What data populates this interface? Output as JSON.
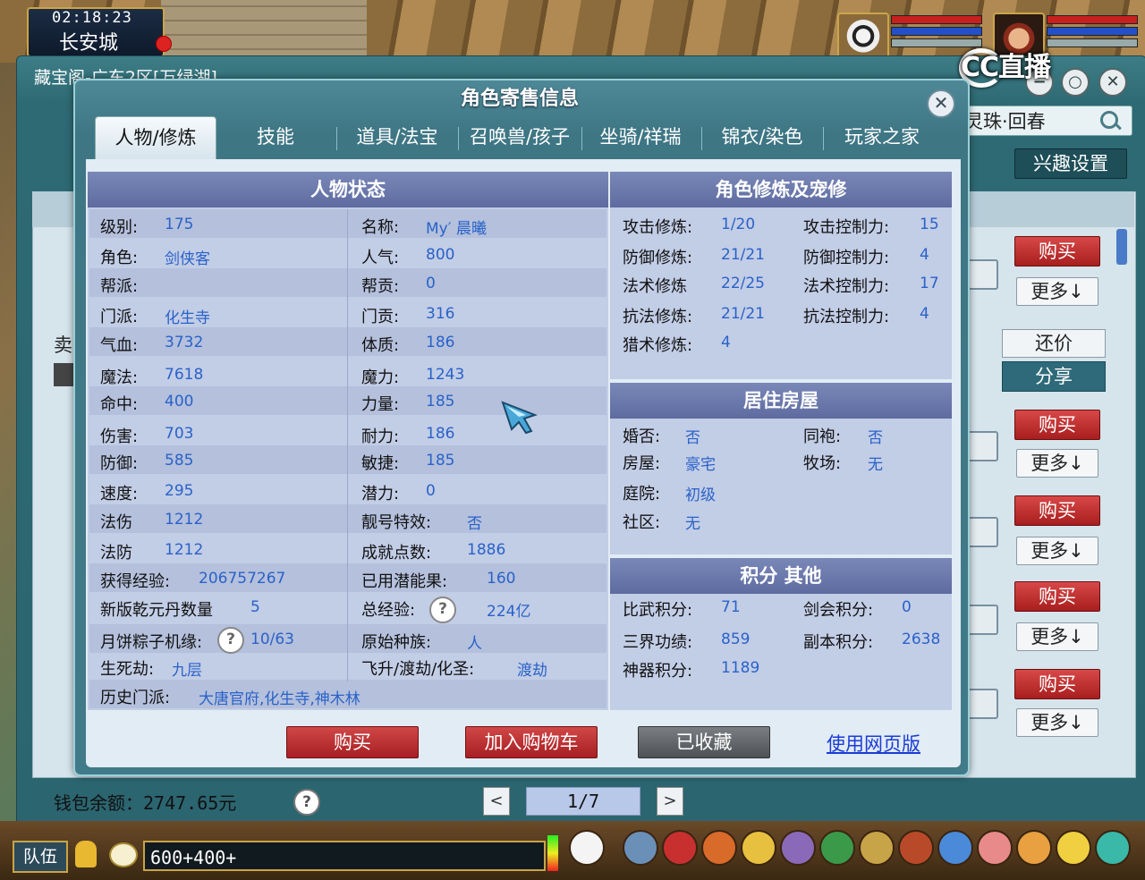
{
  "hud_top": {
    "clock": "02:18:23",
    "location": "长安城"
  },
  "stream_badge": "CC直播",
  "outer_window": {
    "title": "藏宝阁-广东2区[万绿湖]",
    "search_text": "灵珠·回春",
    "interest_button": "兴趣设置",
    "sell_label": "卖",
    "buy_label": "购买",
    "more_label": "更多↓",
    "counter_offer": "还价",
    "share": "分享",
    "wallet": "钱包余额：2747.65元",
    "help": "?",
    "page": "1/7",
    "prev": "<",
    "next": ">"
  },
  "dialog": {
    "title": "角色寄售信息",
    "close": "✕",
    "tabs": [
      "人物/修炼",
      "技能",
      "道具/法宝",
      "召唤兽/孩子",
      "坐骑/祥瑞",
      "锦衣/染色",
      "玩家之家"
    ],
    "status": {
      "header": "人物状态",
      "left": [
        {
          "label": "级别:",
          "value": "175"
        },
        {
          "label": "角色:",
          "value": "剑侠客"
        },
        {
          "label": "帮派:",
          "value": ""
        },
        {
          "label": "门派:",
          "value": "化生寺"
        },
        {
          "label": "气血:",
          "value": "3732"
        },
        {
          "label": "魔法:",
          "value": "7618"
        },
        {
          "label": "命中:",
          "value": "400"
        },
        {
          "label": "伤害:",
          "value": "703"
        },
        {
          "label": "防御:",
          "value": "585"
        },
        {
          "label": "速度:",
          "value": "295"
        },
        {
          "label": "法伤",
          "value": "1212"
        },
        {
          "label": "法防",
          "value": "1212"
        },
        {
          "label": "获得经验:",
          "value": "206757267"
        },
        {
          "label": "新版乾元丹数量",
          "value": "5"
        },
        {
          "label": "月饼粽子机缘:",
          "value": "10/63"
        },
        {
          "label": "生死劫:",
          "value": "九层"
        },
        {
          "label": "历史门派:",
          "value": "大唐官府,化生寺,神木林"
        }
      ],
      "right": [
        {
          "label": "名称:",
          "value": "My′ 晨曦"
        },
        {
          "label": "人气:",
          "value": "800"
        },
        {
          "label": "帮贡:",
          "value": "0"
        },
        {
          "label": "门贡:",
          "value": "316"
        },
        {
          "label": "体质:",
          "value": "186"
        },
        {
          "label": "魔力:",
          "value": "1243"
        },
        {
          "label": "力量:",
          "value": "185"
        },
        {
          "label": "耐力:",
          "value": "186"
        },
        {
          "label": "敏捷:",
          "value": "185"
        },
        {
          "label": "潜力:",
          "value": "0"
        },
        {
          "label": "靓号特效:",
          "value": "否"
        },
        {
          "label": "成就点数:",
          "value": "1886"
        },
        {
          "label": "已用潜能果:",
          "value": "160"
        },
        {
          "label": "总经验:",
          "value": "224亿"
        },
        {
          "label": "原始种族:",
          "value": "人"
        },
        {
          "label": "飞升/渡劫/化圣:",
          "value": "渡劫"
        }
      ]
    },
    "cultivation": {
      "header": "角色修炼及宠修",
      "rows": [
        {
          "l1": "攻击修炼:",
          "v1": "1/20",
          "l2": "攻击控制力:",
          "v2": "15"
        },
        {
          "l1": "防御修炼:",
          "v1": "21/21",
          "l2": "防御控制力:",
          "v2": "4"
        },
        {
          "l1": "法术修炼",
          "v1": "22/25",
          "l2": "法术控制力:",
          "v2": "17"
        },
        {
          "l1": "抗法修炼:",
          "v1": "21/21",
          "l2": "抗法控制力:",
          "v2": "4"
        },
        {
          "l1": "猎术修炼:",
          "v1": "4",
          "l2": "",
          "v2": ""
        }
      ]
    },
    "housing": {
      "header": "居住房屋",
      "rows": [
        {
          "l1": "婚否:",
          "v1": "否",
          "l2": "同袍:",
          "v2": "否"
        },
        {
          "l1": "房屋:",
          "v1": "豪宅",
          "l2": "牧场:",
          "v2": "无"
        },
        {
          "l1": "庭院:",
          "v1": "初级",
          "l2": "",
          "v2": ""
        },
        {
          "l1": "社区:",
          "v1": "无",
          "l2": "",
          "v2": ""
        }
      ]
    },
    "points": {
      "header": "积分 其他",
      "rows": [
        {
          "l1": "比武积分:",
          "v1": "71",
          "l2": "剑会积分:",
          "v2": "0"
        },
        {
          "l1": "三界功绩:",
          "v1": "859",
          "l2": "副本积分:",
          "v2": "2638"
        },
        {
          "l1": "神器积分:",
          "v1": "1189",
          "l2": "",
          "v2": ""
        }
      ]
    },
    "buttons": {
      "buy": "购买",
      "add_cart": "加入购物车",
      "favorited": "已收藏",
      "web": "使用网页版"
    }
  },
  "hud_bottom": {
    "team": "队伍",
    "chat_input": "600+400+"
  },
  "colors": {
    "accent_red": "#b8282a",
    "value_blue": "#2a62c8",
    "pane_header": "#6a78aa",
    "dialog_teal": "#417a88"
  }
}
